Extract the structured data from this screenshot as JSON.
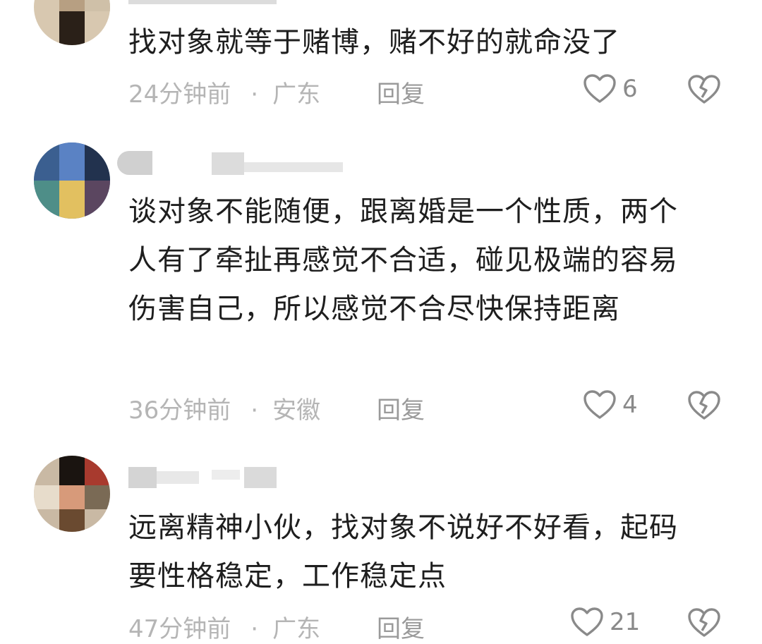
{
  "comments": [
    {
      "username": "",
      "text": "找对象就等于赌博，赌不好的就命没了",
      "time": "24分钟前",
      "location": "广东",
      "reply_label": "回复",
      "likes": "6"
    },
    {
      "username": "",
      "text": "谈对象不能随便，跟离婚是一个性质，两个人有了牵扯再感觉不合适，碰见极端的容易伤害自己，所以感觉不合尽快保持距离",
      "time": "36分钟前",
      "location": "安徽",
      "reply_label": "回复",
      "likes": "4"
    },
    {
      "username": "",
      "text": "远离精神小伙，找对象不说好不好看，起码要性格稳定，工作稳定点",
      "time": "47分钟前",
      "location": "广东",
      "reply_label": "回复",
      "likes": "21"
    }
  ],
  "separator": "·",
  "icons": {
    "like": "heart-outline-icon",
    "dislike": "broken-heart-icon"
  },
  "colors": {
    "text": "#1e1e1e",
    "meta": "#b5b5b5",
    "icon": "#8a8a8a"
  }
}
